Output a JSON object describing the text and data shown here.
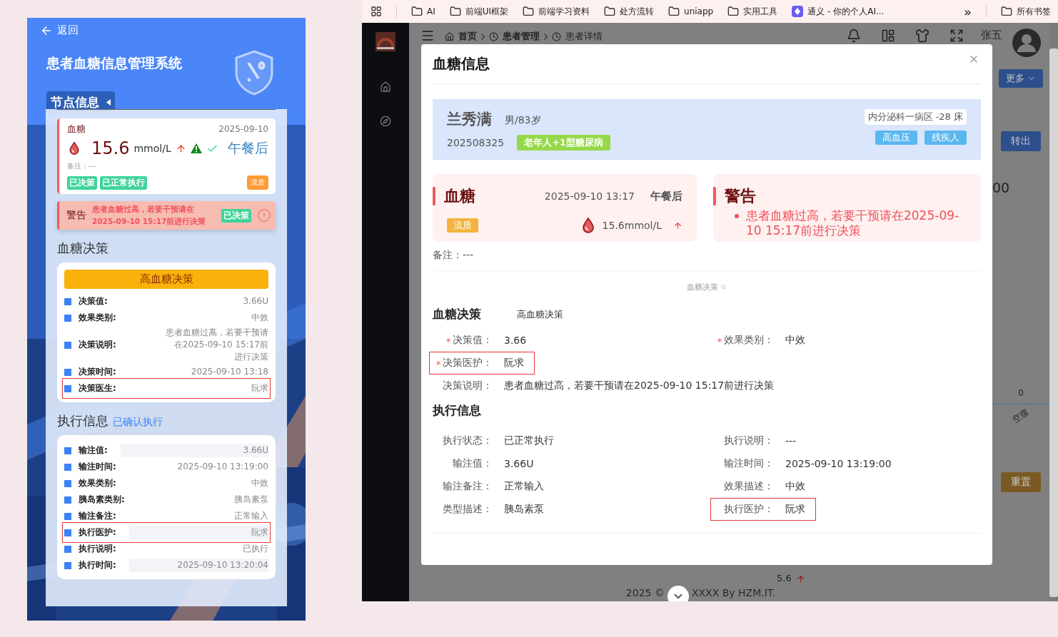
{
  "mobile": {
    "back": "返回",
    "title": "患者血糖信息管理系统",
    "section_tab": "节点信息",
    "reading": {
      "label": "血糖",
      "date": "2025-09-10",
      "value": "15.6",
      "unit": "mmol/L",
      "meal": "午餐后",
      "note": "备注：---",
      "tags": [
        "已决策",
        "已正常执行"
      ],
      "diet": "流质"
    },
    "warning": {
      "label": "警告",
      "text": "患者血糖过高，若要干预请在2025-09-10 15:17前进行决策",
      "tag": "已决策"
    },
    "decision": {
      "heading": "血糖决策",
      "banner": "高血糖决策",
      "rows": [
        {
          "label": "决策值:",
          "value": "3.66U",
          "highlighted": false
        },
        {
          "label": "效果类别:",
          "value": "中效",
          "highlighted": false
        },
        {
          "label": "决策说明:",
          "value": "患者血糖过高，若要干预请在2025-09-10 15:17前进行决策",
          "highlighted": false
        },
        {
          "label": "决策时间:",
          "value": "2025-09-10 13:18",
          "highlighted": false
        },
        {
          "label": "决策医生:",
          "value": "阮求",
          "highlighted": true
        }
      ]
    },
    "execution": {
      "heading": "执行信息",
      "status": "已确认执行",
      "rows": [
        {
          "label": "输注值:",
          "value": "3.66U",
          "shaded": true,
          "highlighted": false
        },
        {
          "label": "输注时间:",
          "value": "2025-09-10 13:19:00",
          "shaded": false,
          "highlighted": false
        },
        {
          "label": "效果类别:",
          "value": "中效",
          "shaded": false,
          "highlighted": false
        },
        {
          "label": "胰岛素类别:",
          "value": "胰岛素泵",
          "shaded": false,
          "highlighted": false
        },
        {
          "label": "输注备注:",
          "value": "正常输入",
          "shaded": false,
          "highlighted": false
        },
        {
          "label": "执行医护:",
          "value": "阮求",
          "shaded": true,
          "highlighted": true
        },
        {
          "label": "执行说明:",
          "value": "已执行",
          "shaded": false,
          "highlighted": false
        },
        {
          "label": "执行时间:",
          "value": "2025-09-10 13:20:04",
          "shaded": true,
          "highlighted": false
        }
      ]
    }
  },
  "bookmarks": {
    "items": [
      {
        "label": "AI",
        "kind": "folder"
      },
      {
        "label": "前端UI框架",
        "kind": "folder"
      },
      {
        "label": "前端学习资料",
        "kind": "folder"
      },
      {
        "label": "处方流转",
        "kind": "folder"
      },
      {
        "label": "uniapp",
        "kind": "folder"
      },
      {
        "label": "实用工具",
        "kind": "folder"
      },
      {
        "label": "通义 - 你的个人AI...",
        "kind": "site"
      }
    ],
    "more": "»",
    "all": "所有书签"
  },
  "app": {
    "breadcrumbs": [
      "首页",
      "患者管理",
      "患者详情"
    ],
    "user": "张五",
    "more_button": "更多",
    "transfer_button": "转出",
    "stat": "00",
    "chart_value": "0",
    "chart_label": "空腹",
    "reset_button": "重置",
    "table_value": "5.6",
    "footer": [
      "2025 ©",
      "XXXX By HZM.IT."
    ]
  },
  "modal": {
    "title": "血糖信息",
    "patient": {
      "name": "兰秀满",
      "info": "男/83岁",
      "id": "202508325",
      "diagnosis": "老年人+1型糖尿病",
      "ward": "内分泌科一病区 -28 床",
      "tags": [
        "高血压",
        "残疾人"
      ]
    },
    "glucose": {
      "label": "血糖",
      "time": "2025-09-10 13:17",
      "meal": "午餐后",
      "diet": "流质",
      "value": "15.6mmol/L"
    },
    "warning": {
      "label": "警告",
      "text": "患者血糖过高，若要干预请在2025-09-10 15:17前进行决策"
    },
    "note": "备注：---",
    "collapse": "血糖决策",
    "decision": {
      "heading": "血糖决策",
      "type": "高血糖决策",
      "fields": [
        {
          "label": "决策值：",
          "value": "3.66",
          "required": true,
          "highlighted": false,
          "wide": false
        },
        {
          "label": "效果类别：",
          "value": "中效",
          "required": true,
          "highlighted": false,
          "wide": false
        },
        {
          "label": "决策医护：",
          "value": "阮求",
          "required": true,
          "highlighted": true,
          "wide": true
        },
        {
          "label": "决策说明：",
          "value": "患者血糖过高，若要干预请在2025-09-10 15:17前进行决策",
          "required": false,
          "highlighted": false,
          "wide": true
        }
      ]
    },
    "execution": {
      "heading": "执行信息",
      "fields": [
        {
          "label": "执行状态：",
          "value": "已正常执行",
          "required": false,
          "highlighted": false,
          "wide": false
        },
        {
          "label": "执行说明：",
          "value": "---",
          "required": false,
          "highlighted": false,
          "wide": false
        },
        {
          "label": "输注值：",
          "value": "3.66U",
          "required": false,
          "highlighted": false,
          "wide": false
        },
        {
          "label": "输注时间：",
          "value": "2025-09-10 13:19:00",
          "required": false,
          "highlighted": false,
          "wide": false
        },
        {
          "label": "输注备注：",
          "value": "正常输入",
          "required": false,
          "highlighted": false,
          "wide": false
        },
        {
          "label": "效果描述：",
          "value": "中效",
          "required": false,
          "highlighted": false,
          "wide": false
        },
        {
          "label": "类型描述：",
          "value": "胰岛素泵",
          "required": false,
          "highlighted": false,
          "wide": false
        },
        {
          "label": "执行医护：",
          "value": "阮求",
          "required": false,
          "highlighted": true,
          "wide": false
        }
      ]
    }
  }
}
